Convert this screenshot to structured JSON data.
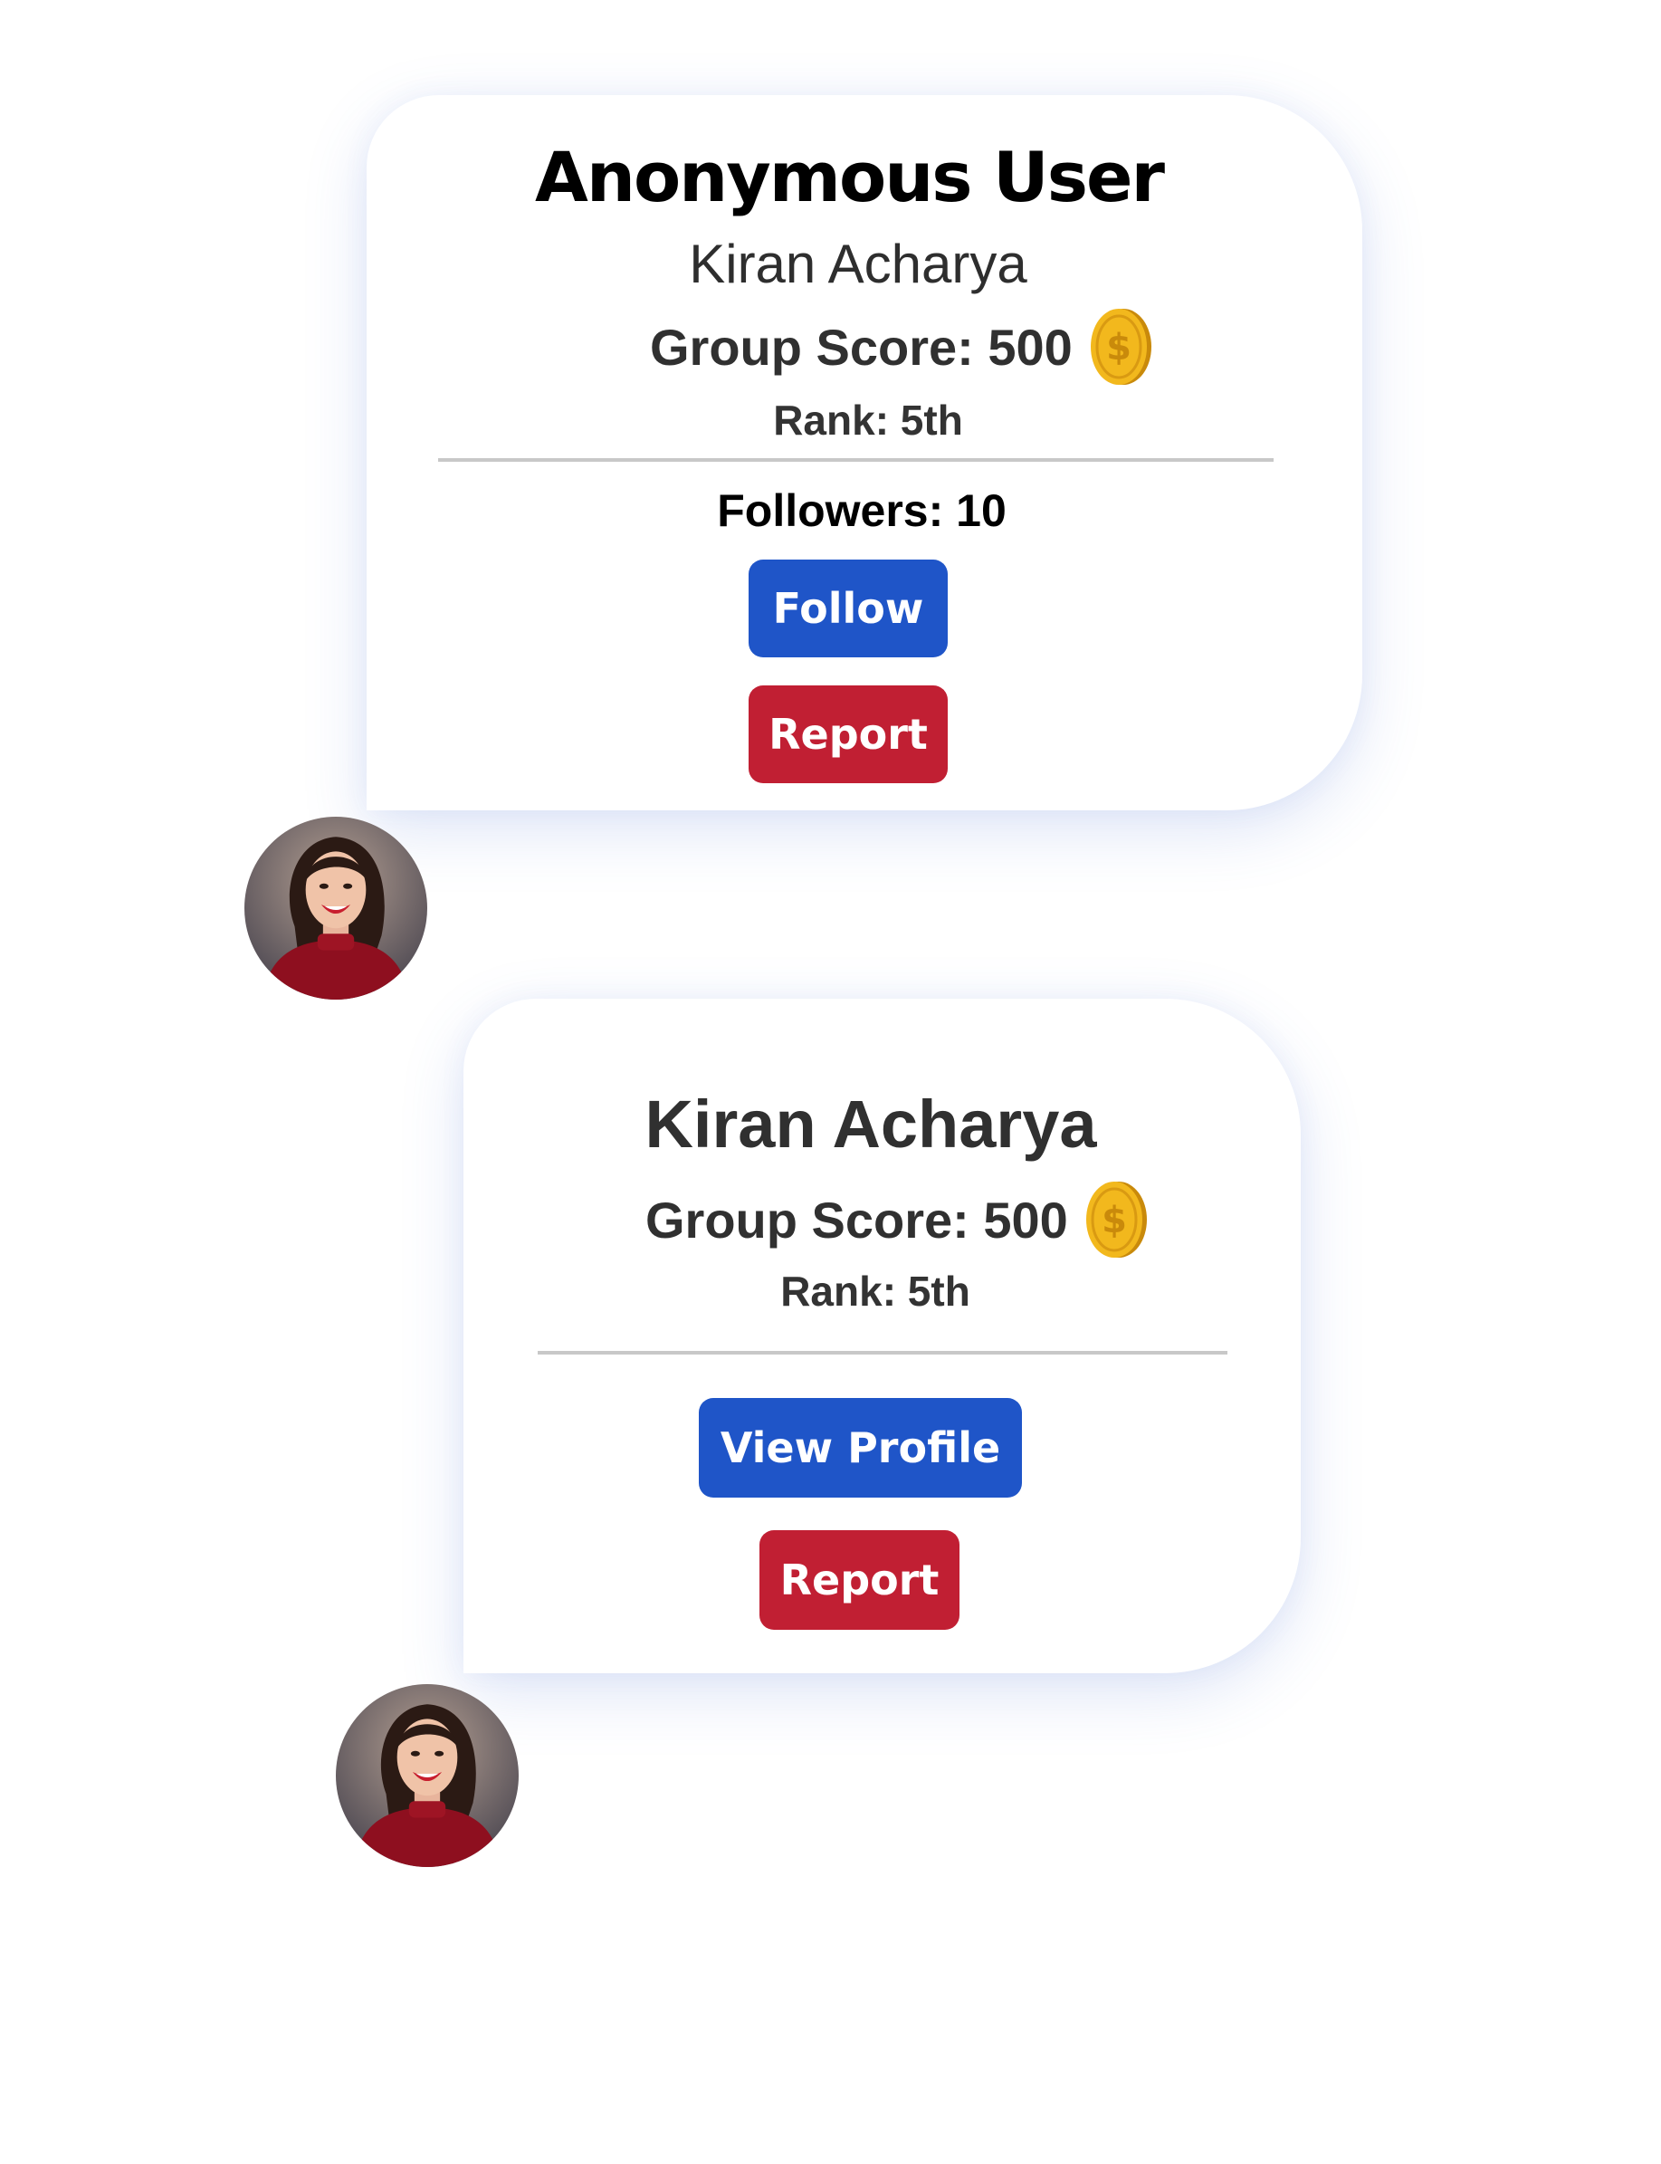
{
  "cards": [
    {
      "title": "Anonymous User",
      "name": "Kiran Acharya",
      "score_text": "Group Score: 500",
      "rank_text": "Rank: 5th",
      "followers_text": "Followers: 10",
      "primary_button": "Follow",
      "secondary_button": "Report"
    },
    {
      "title": "Kiran Acharya",
      "score_text": "Group Score: 500",
      "rank_text": "Rank: 5th",
      "primary_button": "View Profile",
      "secondary_button": "Report"
    }
  ],
  "icons": {
    "coin": "dollar-coin-icon",
    "avatar": "user-avatar"
  },
  "colors": {
    "primary_button": "#1f55c8",
    "report_button": "#c11f33",
    "coin": "#f2b81d",
    "divider": "#c8c8c8"
  }
}
